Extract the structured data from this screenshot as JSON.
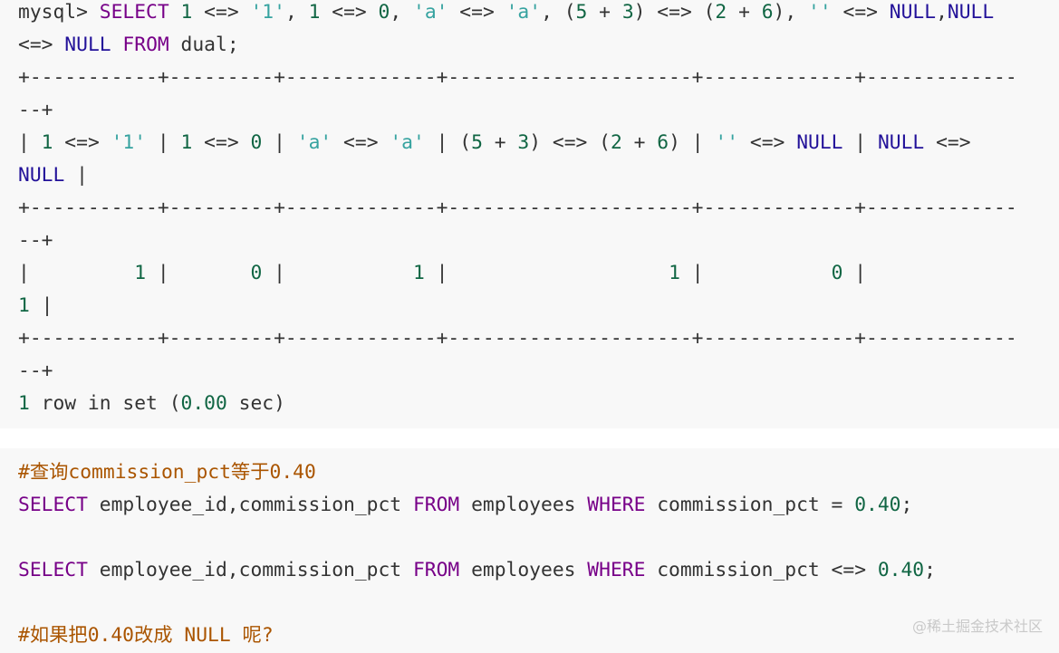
{
  "block1": {
    "lines": [
      [
        [
          "mysql> ",
          "p"
        ],
        [
          "SELECT",
          "kw"
        ],
        [
          " ",
          "p"
        ],
        [
          "1",
          "num"
        ],
        [
          " <=> ",
          "p"
        ],
        [
          "'1'",
          "str"
        ],
        [
          ", ",
          "p"
        ],
        [
          "1",
          "num"
        ],
        [
          " <=> ",
          "p"
        ],
        [
          "0",
          "num"
        ],
        [
          ", ",
          "p"
        ],
        [
          "'a'",
          "str"
        ],
        [
          " <=> ",
          "p"
        ],
        [
          "'a'",
          "str"
        ],
        [
          ", (",
          "p"
        ],
        [
          "5",
          "num"
        ],
        [
          " + ",
          "p"
        ],
        [
          "3",
          "num"
        ],
        [
          ") <=> (",
          "p"
        ],
        [
          "2",
          "num"
        ],
        [
          " + ",
          "p"
        ],
        [
          "6",
          "num"
        ],
        [
          "), ",
          "p"
        ],
        [
          "''",
          "str"
        ],
        [
          " <=> ",
          "p"
        ],
        [
          "NULL",
          "atom"
        ],
        [
          ",",
          "p"
        ],
        [
          "NULL",
          "atom"
        ]
      ],
      [
        [
          "<=> ",
          "p"
        ],
        [
          "NULL",
          "atom"
        ],
        [
          " ",
          "p"
        ],
        [
          "FROM",
          "kw"
        ],
        [
          " dual;",
          "p"
        ]
      ],
      [
        [
          "+-----------+---------+-------------+---------------------+-------------+-------------",
          "p"
        ]
      ],
      [
        [
          "--+",
          "p"
        ]
      ],
      [
        [
          "| ",
          "p"
        ],
        [
          "1",
          "num"
        ],
        [
          " <=> ",
          "p"
        ],
        [
          "'1'",
          "str"
        ],
        [
          " | ",
          "p"
        ],
        [
          "1",
          "num"
        ],
        [
          " <=> ",
          "p"
        ],
        [
          "0",
          "num"
        ],
        [
          " | ",
          "p"
        ],
        [
          "'a'",
          "str"
        ],
        [
          " <=> ",
          "p"
        ],
        [
          "'a'",
          "str"
        ],
        [
          " | (",
          "p"
        ],
        [
          "5",
          "num"
        ],
        [
          " + ",
          "p"
        ],
        [
          "3",
          "num"
        ],
        [
          ") <=> (",
          "p"
        ],
        [
          "2",
          "num"
        ],
        [
          " + ",
          "p"
        ],
        [
          "6",
          "num"
        ],
        [
          ") | ",
          "p"
        ],
        [
          "''",
          "str"
        ],
        [
          " <=> ",
          "p"
        ],
        [
          "NULL",
          "atom"
        ],
        [
          " | ",
          "p"
        ],
        [
          "NULL",
          "atom"
        ],
        [
          " <=>",
          "p"
        ]
      ],
      [
        [
          "NULL",
          "atom"
        ],
        [
          " |",
          "p"
        ]
      ],
      [
        [
          "+-----------+---------+-------------+---------------------+-------------+-------------",
          "p"
        ]
      ],
      [
        [
          "--+",
          "p"
        ]
      ],
      [
        [
          "|         ",
          "p"
        ],
        [
          "1",
          "num"
        ],
        [
          " |       ",
          "p"
        ],
        [
          "0",
          "num"
        ],
        [
          " |           ",
          "p"
        ],
        [
          "1",
          "num"
        ],
        [
          " |                   ",
          "p"
        ],
        [
          "1",
          "num"
        ],
        [
          " |           ",
          "p"
        ],
        [
          "0",
          "num"
        ],
        [
          " |",
          "p"
        ]
      ],
      [
        [
          "1",
          "num"
        ],
        [
          " |",
          "p"
        ]
      ],
      [
        [
          "+-----------+---------+-------------+---------------------+-------------+-------------",
          "p"
        ]
      ],
      [
        [
          "--+",
          "p"
        ]
      ],
      [
        [
          "1",
          "num"
        ],
        [
          " row in set (",
          "p"
        ],
        [
          "0.00",
          "num"
        ],
        [
          " sec)",
          "p"
        ]
      ]
    ]
  },
  "block2": {
    "lines": [
      [
        [
          "#查询commission_pct等于0.40",
          "cmt"
        ]
      ],
      [
        [
          "SELECT",
          "kw"
        ],
        [
          " employee_id,commission_pct ",
          "p"
        ],
        [
          "FROM",
          "kw"
        ],
        [
          " employees ",
          "p"
        ],
        [
          "WHERE",
          "kw"
        ],
        [
          " commission_pct = ",
          "p"
        ],
        [
          "0.40",
          "num"
        ],
        [
          ";",
          "p"
        ]
      ],
      [
        [
          "",
          "p"
        ]
      ],
      [
        [
          "SELECT",
          "kw"
        ],
        [
          " employee_id,commission_pct ",
          "p"
        ],
        [
          "FROM",
          "kw"
        ],
        [
          " employees ",
          "p"
        ],
        [
          "WHERE",
          "kw"
        ],
        [
          " commission_pct <=> ",
          "p"
        ],
        [
          "0.40",
          "num"
        ],
        [
          ";",
          "p"
        ]
      ],
      [
        [
          "",
          "p"
        ]
      ],
      [
        [
          "#如果把0.40改成 NULL 呢?",
          "cmt"
        ]
      ]
    ]
  },
  "watermark": "@稀土掘金技术社区",
  "colors": {
    "keyword": "#770088",
    "atom": "#221199",
    "number": "#116644",
    "string": "#36a3a0",
    "comment": "#aa5500",
    "plain": "#333333",
    "block_bg": "#f8f8f8"
  }
}
